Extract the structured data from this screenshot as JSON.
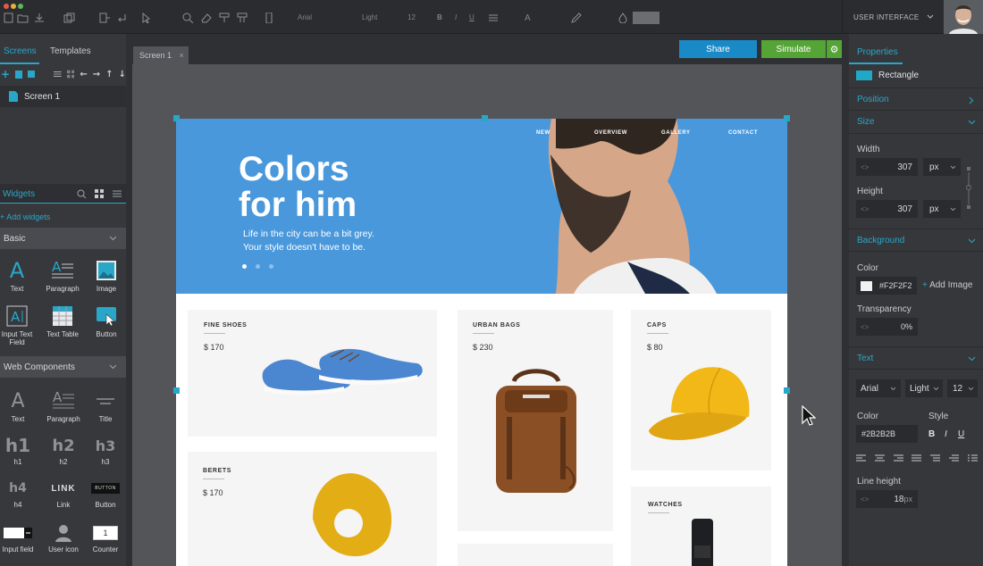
{
  "toolbar": {
    "font_family": "Arial",
    "font_weight": "Light",
    "font_size": "12",
    "ui_mode": "USER INTERFACE"
  },
  "left_panel": {
    "tabs": [
      "Screens",
      "Templates"
    ],
    "screens": [
      "Screen 1"
    ],
    "widgets_tab": "Widgets",
    "add_widgets": "+ Add widgets",
    "basic_section": "Basic",
    "basic_widgets": [
      "Text",
      "Paragraph",
      "Image",
      "Input Text Field",
      "Text Table",
      "Button"
    ],
    "web_section": "Web Components",
    "web_widgets": [
      "Text",
      "Paragraph",
      "Title",
      "h1",
      "h2",
      "h3",
      "h4",
      "Link",
      "Button",
      "Input field",
      "User icon",
      "Counter"
    ],
    "web_glyphs": {
      "h1": "h1",
      "h2": "h2",
      "h3": "h3",
      "h4": "h4",
      "link": "LINK",
      "button": "BUTTON",
      "counter": "1"
    }
  },
  "canvas": {
    "screen_tab": "Screen 1",
    "share_label": "Share",
    "simulate_label": "Simulate",
    "page": {
      "nav": [
        "NEW",
        "OVERVIEW",
        "GALLERY",
        "CONTACT"
      ],
      "hero_title_line1": "Colors",
      "hero_title_line2": "for him",
      "hero_sub1": "Life in the city can be a bit grey.",
      "hero_sub2": "Your style doesn't have to be.",
      "products": [
        {
          "title": "FINE SHOES",
          "price": "$ 170"
        },
        {
          "title": "URBAN BAGS",
          "price": "$ 230"
        },
        {
          "title": "CAPS",
          "price": "$ 80"
        },
        {
          "title": "BERETS",
          "price": "$ 170"
        },
        {
          "title": "WATCHES",
          "price": ""
        }
      ]
    }
  },
  "properties": {
    "tab": "Properties",
    "element": "Rectangle",
    "position_label": "Position",
    "size_label": "Size",
    "width_label": "Width",
    "width_value": "307",
    "height_label": "Height",
    "height_value": "307",
    "unit": "px",
    "background_label": "Background",
    "color_label": "Color",
    "bg_color": "#F2F2F2",
    "add_image": "Add Image",
    "transparency_label": "Transparency",
    "transparency_value": "0%",
    "text_label": "Text",
    "font": "Arial",
    "weight": "Light",
    "size": "12",
    "text_color_label": "Color",
    "style_label": "Style",
    "text_color": "#2B2B2B",
    "style_b": "B",
    "style_i": "I",
    "style_u": "U",
    "line_height_label": "Line height",
    "line_height_value": "18",
    "line_height_unit": "px"
  },
  "colors": {
    "accent": "#29a7c9",
    "share": "#1a8ac7",
    "simulate": "#55a436",
    "hero": "#4a98dc"
  }
}
